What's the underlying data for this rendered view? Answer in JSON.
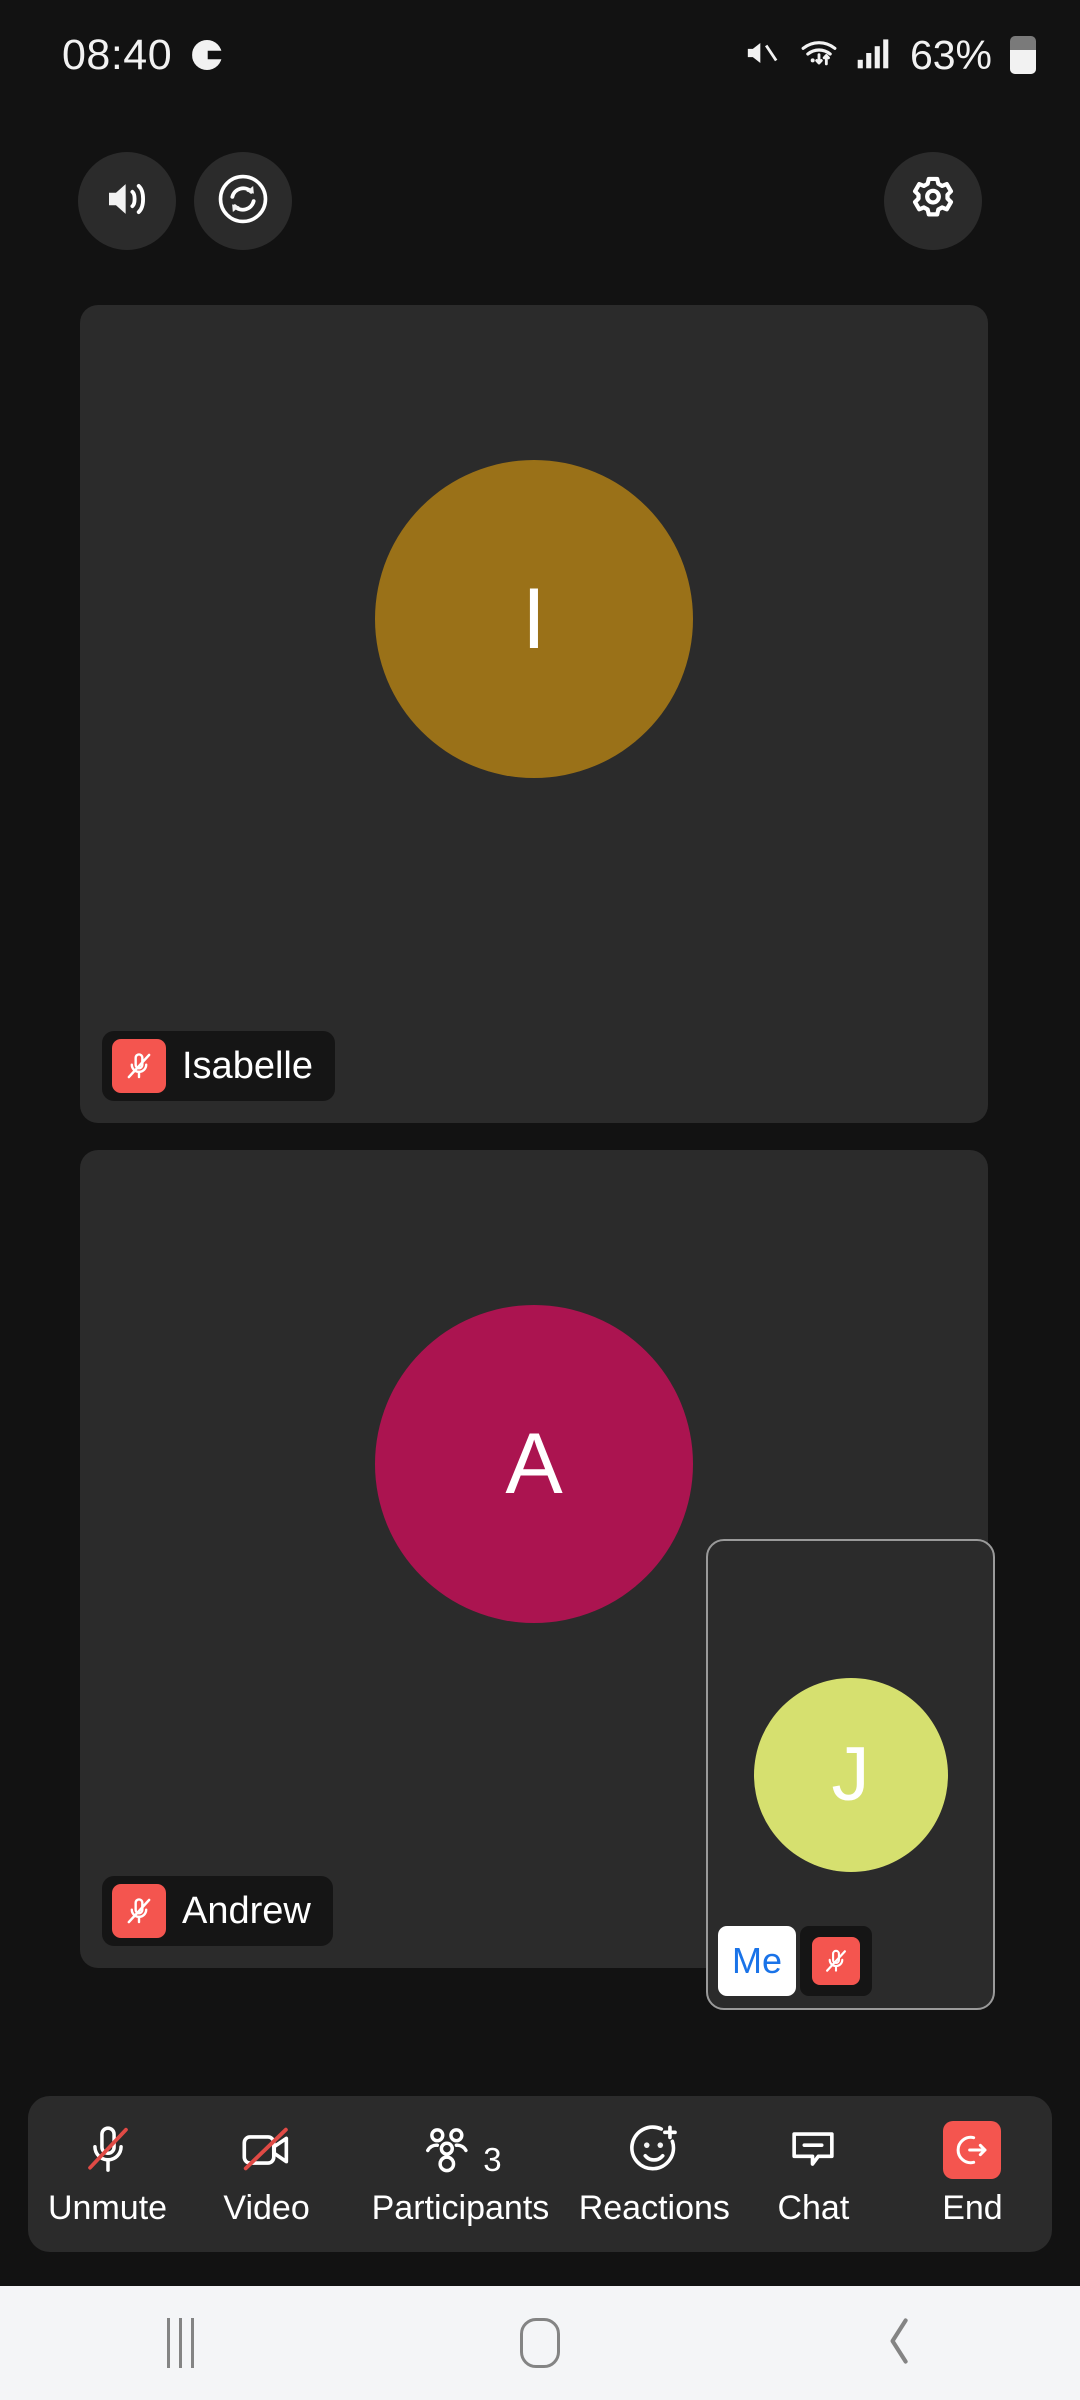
{
  "status_bar": {
    "time": "08:40",
    "app_icon": "g-app-icon",
    "icons": [
      "mute-icon",
      "wifi-icon",
      "signal-bars-icon"
    ],
    "battery_percent": "63%",
    "battery_level": 63
  },
  "top_controls": {
    "speaker": {
      "label": "Speaker",
      "icon": "speaker-icon"
    },
    "flip_camera": {
      "label": "Switch camera",
      "icon": "camera-switch-icon"
    },
    "settings": {
      "label": "Settings",
      "icon": "gear-icon"
    }
  },
  "participants": [
    {
      "name": "Isabelle",
      "initial": "I",
      "avatar_color": "#9a7118",
      "muted": true,
      "mic_icon": "mic-muted-icon"
    },
    {
      "name": "Andrew",
      "initial": "A",
      "avatar_color": "#ab1450",
      "muted": true,
      "mic_icon": "mic-muted-icon"
    }
  ],
  "self_view": {
    "label": "Me",
    "initial": "J",
    "avatar_color": "#d6e06f",
    "muted": true,
    "mic_icon": "mic-muted-icon",
    "label_color": "#1a73e8"
  },
  "toolbar": {
    "items": [
      {
        "label": "Unmute",
        "icon": "mic-muted-icon",
        "count": ""
      },
      {
        "label": "Video",
        "icon": "video-off-icon",
        "count": ""
      },
      {
        "label": "Participants",
        "icon": "participants-icon",
        "count": "3"
      },
      {
        "label": "Reactions",
        "icon": "reactions-icon",
        "count": ""
      },
      {
        "label": "Chat",
        "icon": "chat-icon",
        "count": ""
      },
      {
        "label": "End",
        "icon": "end-call-icon",
        "count": ""
      }
    ],
    "end_color": "#f4554f"
  },
  "nav_bar": {
    "recents": "recents-icon",
    "home": "home-icon",
    "back": "back-icon"
  },
  "colors": {
    "background": "#121212",
    "tile": "#2b2b2b",
    "accent_red": "#f4554f",
    "accent_blue": "#1a73e8"
  }
}
